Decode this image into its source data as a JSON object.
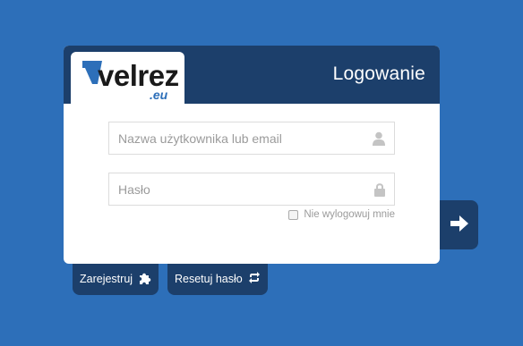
{
  "app": {
    "logo": {
      "text": "velrez",
      "suffix": ".eu"
    },
    "title": "Logowanie"
  },
  "login_form": {
    "username": {
      "placeholder": "Nazwa użytkownika lub email",
      "value": "",
      "icon": "user-icon"
    },
    "password": {
      "placeholder": "Hasło",
      "value": "",
      "icon": "lock-icon"
    },
    "remember_label": "Nie wylogowuj mnie",
    "remember_checked": false,
    "submit_icon": "arrow-right-icon"
  },
  "actions": {
    "register_label": "Zarejestruj",
    "register_icon": "puzzle-icon",
    "reset_label": "Resetuj hasło",
    "reset_icon": "refresh-icon"
  },
  "colors": {
    "background": "#2d6fb9",
    "header": "#1c3f6b",
    "card": "#ffffff"
  }
}
